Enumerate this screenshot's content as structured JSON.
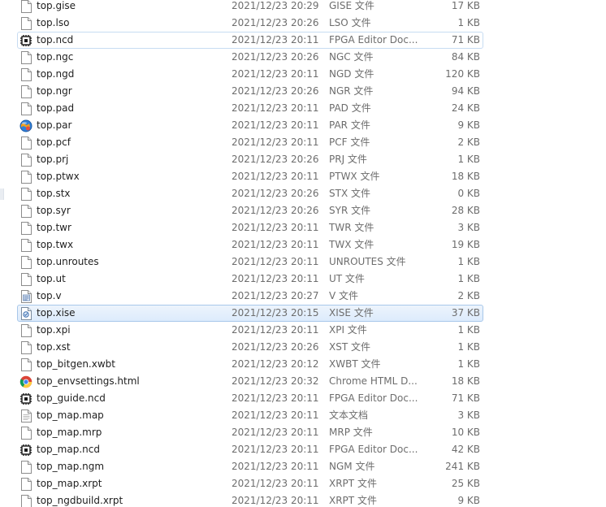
{
  "files": [
    {
      "name": "top.gise",
      "date": "2021/12/23 20:29",
      "type": "GISE 文件",
      "size": "17 KB",
      "icon": "blank-file-icon"
    },
    {
      "name": "top.lso",
      "date": "2021/12/23 20:26",
      "type": "LSO 文件",
      "size": "1 KB",
      "icon": "blank-file-icon"
    },
    {
      "name": "top.ncd",
      "date": "2021/12/23 20:11",
      "type": "FPGA Editor Doc...",
      "size": "71 KB",
      "icon": "fpga-editor-icon",
      "state": "hover"
    },
    {
      "name": "top.ngc",
      "date": "2021/12/23 20:26",
      "type": "NGC 文件",
      "size": "84 KB",
      "icon": "blank-file-icon"
    },
    {
      "name": "top.ngd",
      "date": "2021/12/23 20:11",
      "type": "NGD 文件",
      "size": "120 KB",
      "icon": "blank-file-icon"
    },
    {
      "name": "top.ngr",
      "date": "2021/12/23 20:26",
      "type": "NGR 文件",
      "size": "94 KB",
      "icon": "blank-file-icon"
    },
    {
      "name": "top.pad",
      "date": "2021/12/23 20:11",
      "type": "PAD 文件",
      "size": "24 KB",
      "icon": "blank-file-icon"
    },
    {
      "name": "top.par",
      "date": "2021/12/23 20:11",
      "type": "PAR 文件",
      "size": "9 KB",
      "icon": "par-globe-icon"
    },
    {
      "name": "top.pcf",
      "date": "2021/12/23 20:11",
      "type": "PCF 文件",
      "size": "2 KB",
      "icon": "blank-file-icon"
    },
    {
      "name": "top.prj",
      "date": "2021/12/23 20:26",
      "type": "PRJ 文件",
      "size": "1 KB",
      "icon": "blank-file-icon"
    },
    {
      "name": "top.ptwx",
      "date": "2021/12/23 20:11",
      "type": "PTWX 文件",
      "size": "18 KB",
      "icon": "blank-file-icon"
    },
    {
      "name": "top.stx",
      "date": "2021/12/23 20:26",
      "type": "STX 文件",
      "size": "0 KB",
      "icon": "blank-file-icon"
    },
    {
      "name": "top.syr",
      "date": "2021/12/23 20:26",
      "type": "SYR 文件",
      "size": "28 KB",
      "icon": "blank-file-icon"
    },
    {
      "name": "top.twr",
      "date": "2021/12/23 20:11",
      "type": "TWR 文件",
      "size": "3 KB",
      "icon": "blank-file-icon"
    },
    {
      "name": "top.twx",
      "date": "2021/12/23 20:11",
      "type": "TWX 文件",
      "size": "19 KB",
      "icon": "blank-file-icon"
    },
    {
      "name": "top.unroutes",
      "date": "2021/12/23 20:11",
      "type": "UNROUTES 文件",
      "size": "1 KB",
      "icon": "blank-file-icon"
    },
    {
      "name": "top.ut",
      "date": "2021/12/23 20:11",
      "type": "UT 文件",
      "size": "1 KB",
      "icon": "blank-file-icon"
    },
    {
      "name": "top.v",
      "date": "2021/12/23 20:27",
      "type": "V 文件",
      "size": "2 KB",
      "icon": "verilog-file-icon"
    },
    {
      "name": "top.xise",
      "date": "2021/12/23 20:15",
      "type": "XISE 文件",
      "size": "37 KB",
      "icon": "xise-project-icon",
      "state": "selected"
    },
    {
      "name": "top.xpi",
      "date": "2021/12/23 20:11",
      "type": "XPI 文件",
      "size": "1 KB",
      "icon": "blank-file-icon"
    },
    {
      "name": "top.xst",
      "date": "2021/12/23 20:26",
      "type": "XST 文件",
      "size": "1 KB",
      "icon": "blank-file-icon"
    },
    {
      "name": "top_bitgen.xwbt",
      "date": "2021/12/23 20:12",
      "type": "XWBT 文件",
      "size": "1 KB",
      "icon": "blank-file-icon"
    },
    {
      "name": "top_envsettings.html",
      "date": "2021/12/23 20:32",
      "type": "Chrome HTML D...",
      "size": "18 KB",
      "icon": "chrome-icon"
    },
    {
      "name": "top_guide.ncd",
      "date": "2021/12/23 20:11",
      "type": "FPGA Editor Doc...",
      "size": "71 KB",
      "icon": "fpga-editor-icon"
    },
    {
      "name": "top_map.map",
      "date": "2021/12/23 20:11",
      "type": "文本文档",
      "size": "3 KB",
      "icon": "text-document-icon"
    },
    {
      "name": "top_map.mrp",
      "date": "2021/12/23 20:11",
      "type": "MRP 文件",
      "size": "10 KB",
      "icon": "blank-file-icon"
    },
    {
      "name": "top_map.ncd",
      "date": "2021/12/23 20:11",
      "type": "FPGA Editor Doc...",
      "size": "42 KB",
      "icon": "fpga-editor-icon"
    },
    {
      "name": "top_map.ngm",
      "date": "2021/12/23 20:11",
      "type": "NGM 文件",
      "size": "241 KB",
      "icon": "blank-file-icon"
    },
    {
      "name": "top_map.xrpt",
      "date": "2021/12/23 20:11",
      "type": "XRPT 文件",
      "size": "25 KB",
      "icon": "blank-file-icon"
    },
    {
      "name": "top_ngdbuild.xrpt",
      "date": "2021/12/23 20:11",
      "type": "XRPT 文件",
      "size": "9 KB",
      "icon": "blank-file-icon"
    }
  ],
  "colors": {
    "selection_border": "#a8c7ea",
    "selection_fill": "#dcebfc",
    "hover_border": "#c7dcf2",
    "secondary_text": "#6d6d6d",
    "primary_text": "#1e1e1e"
  }
}
